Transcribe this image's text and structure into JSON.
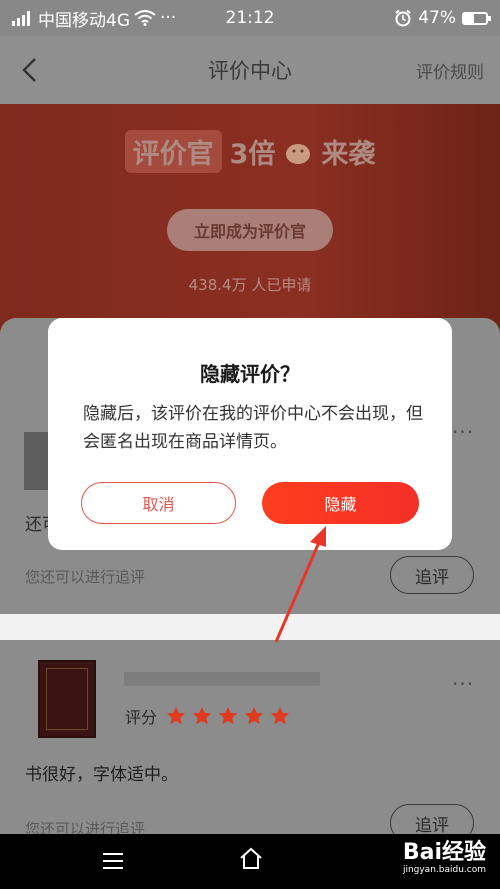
{
  "status": {
    "carrier": "中国移动4G",
    "time": "21:12",
    "battery": "47%",
    "battery_level": 0.47,
    "more": "···"
  },
  "nav": {
    "title": "评价中心",
    "rules": "评价规则"
  },
  "banner": {
    "badge": "评价官",
    "multiplier": "3倍",
    "coming": "来袭",
    "button": "立即成为评价官",
    "count": "438.4万 人已申请"
  },
  "review1": {
    "text_partial": "还可",
    "hint": "您还可以进行追评",
    "follow": "追评",
    "dots": "···"
  },
  "review2": {
    "rating_label": "评分",
    "stars": 5,
    "text": "书很好，字体适中。",
    "hint": "您还可以进行追评",
    "follow": "追评",
    "dots": "···"
  },
  "dialog": {
    "title": "隐藏评价？",
    "message": "隐藏后，该评价在我的评价中心不会出现，但会匿名出现在商品详情页。",
    "cancel": "取消",
    "confirm": "隐藏"
  },
  "watermark": {
    "brand": "Bai经验",
    "url": "jingyan.baidu.com"
  },
  "colors": {
    "accent": "#f42f26",
    "star": "#e03a1e"
  }
}
